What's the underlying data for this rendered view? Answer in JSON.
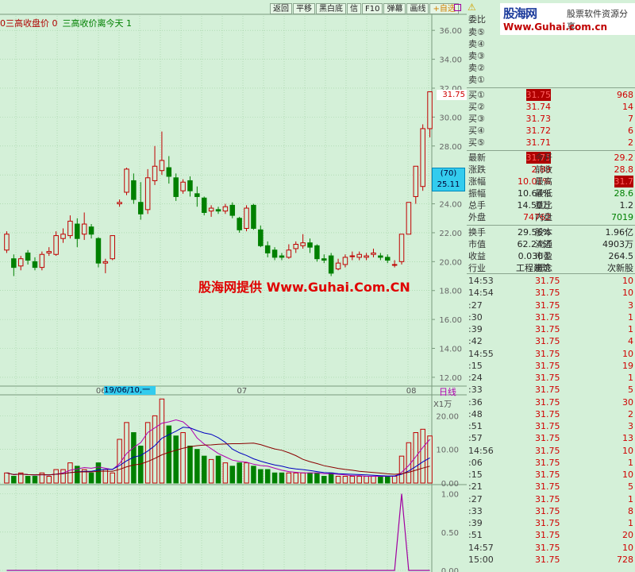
{
  "toolbar": {
    "buttons": [
      "返回",
      "平移",
      "黑白底",
      "信",
      "F10",
      "弹幕",
      "画线",
      "+自选"
    ]
  },
  "legend": {
    "text1": "0三高收盘价 0",
    "text2": "三高收价离今天 1"
  },
  "chart_data": [
    {
      "type": "candlestick",
      "title": "",
      "y_ticks": [
        "36.00",
        "34.00",
        "32.00",
        "30.00",
        "28.00",
        "26.00",
        "24.00",
        "22.00",
        "20.00",
        "18.00",
        "16.00",
        "14.00",
        "12.00"
      ],
      "ylim": [
        11.5,
        37.0
      ],
      "x_ticks": [
        "06",
        "07",
        "08"
      ],
      "candles": [
        {
          "o": 20.8,
          "c": 21.9,
          "h": 22.1,
          "l": 20.6
        },
        {
          "o": 20.2,
          "c": 19.6,
          "h": 20.5,
          "l": 19.0
        },
        {
          "o": 19.7,
          "c": 20.2,
          "h": 20.4,
          "l": 19.4
        },
        {
          "o": 20.6,
          "c": 20.1,
          "h": 20.8,
          "l": 19.8
        },
        {
          "o": 20.0,
          "c": 19.6,
          "h": 20.3,
          "l": 19.4
        },
        {
          "o": 19.6,
          "c": 20.5,
          "h": 20.7,
          "l": 19.4
        },
        {
          "o": 20.6,
          "c": 20.7,
          "h": 21.0,
          "l": 20.4
        },
        {
          "o": 20.5,
          "c": 21.8,
          "h": 22.1,
          "l": 20.4
        },
        {
          "o": 21.6,
          "c": 21.9,
          "h": 22.3,
          "l": 21.3
        },
        {
          "o": 21.8,
          "c": 22.8,
          "h": 23.2,
          "l": 21.6
        },
        {
          "o": 22.6,
          "c": 21.6,
          "h": 23.0,
          "l": 21.0
        },
        {
          "o": 21.9,
          "c": 22.6,
          "h": 23.4,
          "l": 21.5
        },
        {
          "o": 22.4,
          "c": 21.9,
          "h": 22.6,
          "l": 21.6
        },
        {
          "o": 21.6,
          "c": 19.9,
          "h": 21.7,
          "l": 19.6
        },
        {
          "o": 19.9,
          "c": 20.0,
          "h": 20.2,
          "l": 19.2
        },
        {
          "o": 20.2,
          "c": 21.8,
          "h": 21.8,
          "l": 20.1
        },
        {
          "o": 24.0,
          "c": 24.1,
          "h": 24.3,
          "l": 23.8
        },
        {
          "o": 24.8,
          "c": 26.4,
          "h": 26.5,
          "l": 24.6
        },
        {
          "o": 25.6,
          "c": 24.3,
          "h": 26.1,
          "l": 24.0
        },
        {
          "o": 24.1,
          "c": 23.3,
          "h": 25.5,
          "l": 22.9
        },
        {
          "o": 23.6,
          "c": 25.8,
          "h": 26.4,
          "l": 23.3
        },
        {
          "o": 25.6,
          "c": 26.6,
          "h": 28.0,
          "l": 25.3
        },
        {
          "o": 26.3,
          "c": 27.0,
          "h": 29.0,
          "l": 26.0
        },
        {
          "o": 26.5,
          "c": 25.9,
          "h": 27.3,
          "l": 25.4
        },
        {
          "o": 25.8,
          "c": 24.5,
          "h": 26.1,
          "l": 24.2
        },
        {
          "o": 24.9,
          "c": 25.5,
          "h": 25.7,
          "l": 24.7
        },
        {
          "o": 25.6,
          "c": 24.9,
          "h": 25.9,
          "l": 24.5
        },
        {
          "o": 24.7,
          "c": 24.5,
          "h": 25.2,
          "l": 23.8
        },
        {
          "o": 24.4,
          "c": 23.4,
          "h": 24.5,
          "l": 23.2
        },
        {
          "o": 23.5,
          "c": 23.7,
          "h": 23.9,
          "l": 23.1
        },
        {
          "o": 23.6,
          "c": 23.5,
          "h": 23.8,
          "l": 23.3
        },
        {
          "o": 23.5,
          "c": 23.8,
          "h": 24.0,
          "l": 23.3
        },
        {
          "o": 23.9,
          "c": 23.2,
          "h": 24.1,
          "l": 23.0
        },
        {
          "o": 23.0,
          "c": 22.2,
          "h": 23.1,
          "l": 22.0
        },
        {
          "o": 22.3,
          "c": 23.7,
          "h": 23.9,
          "l": 22.1
        },
        {
          "o": 23.9,
          "c": 22.3,
          "h": 24.0,
          "l": 22.2
        },
        {
          "o": 22.2,
          "c": 21.1,
          "h": 22.5,
          "l": 21.0
        },
        {
          "o": 21.1,
          "c": 20.6,
          "h": 21.4,
          "l": 20.3
        },
        {
          "o": 20.8,
          "c": 20.3,
          "h": 21.0,
          "l": 20.1
        },
        {
          "o": 20.4,
          "c": 20.3,
          "h": 20.6,
          "l": 20.1
        },
        {
          "o": 20.3,
          "c": 20.8,
          "h": 21.2,
          "l": 20.2
        },
        {
          "o": 20.9,
          "c": 21.2,
          "h": 21.4,
          "l": 20.6
        },
        {
          "o": 21.1,
          "c": 21.3,
          "h": 21.9,
          "l": 20.9
        },
        {
          "o": 21.3,
          "c": 21.0,
          "h": 21.6,
          "l": 20.6
        },
        {
          "o": 21.1,
          "c": 20.2,
          "h": 21.2,
          "l": 20.0
        },
        {
          "o": 20.2,
          "c": 20.1,
          "h": 20.5,
          "l": 19.9
        },
        {
          "o": 20.4,
          "c": 19.2,
          "h": 20.6,
          "l": 19.0
        },
        {
          "o": 19.5,
          "c": 19.9,
          "h": 20.2,
          "l": 19.4
        },
        {
          "o": 19.8,
          "c": 20.3,
          "h": 20.5,
          "l": 19.6
        },
        {
          "o": 20.4,
          "c": 20.4,
          "h": 20.7,
          "l": 20.1
        },
        {
          "o": 20.3,
          "c": 20.5,
          "h": 20.7,
          "l": 20.1
        },
        {
          "o": 20.3,
          "c": 20.4,
          "h": 20.6,
          "l": 20.1
        },
        {
          "o": 20.5,
          "c": 20.6,
          "h": 20.9,
          "l": 20.3
        },
        {
          "o": 20.4,
          "c": 20.3,
          "h": 20.6,
          "l": 20.1
        },
        {
          "o": 20.3,
          "c": 20.1,
          "h": 20.5,
          "l": 19.9
        },
        {
          "o": 19.8,
          "c": 19.8,
          "h": 20.1,
          "l": 19.6
        },
        {
          "o": 20.0,
          "c": 21.9,
          "h": 21.9,
          "l": 19.8
        },
        {
          "o": 21.9,
          "c": 24.1,
          "h": 24.1,
          "l": 21.9
        },
        {
          "o": 24.5,
          "c": 26.6,
          "h": 26.6,
          "l": 24.0
        },
        {
          "o": 25.2,
          "c": 29.2,
          "h": 29.5,
          "l": 24.9
        },
        {
          "o": 29.2,
          "c": 31.75,
          "h": 31.75,
          "l": 28.6
        }
      ]
    },
    {
      "type": "bar",
      "title": "",
      "unit": "X1万",
      "y_ticks": [
        "20.00",
        "10.00",
        "0.00"
      ],
      "ylim": [
        0,
        26
      ],
      "values": [
        3,
        2,
        3,
        2,
        2,
        3,
        2,
        4,
        4,
        6,
        5,
        4,
        3,
        6,
        4,
        3,
        13,
        18,
        15,
        11,
        18,
        20,
        25,
        17,
        14,
        15,
        11,
        10,
        8,
        7,
        8,
        6,
        5,
        6,
        6,
        5,
        4,
        4,
        3,
        3,
        3,
        3,
        3,
        3,
        3,
        2,
        3,
        2,
        2,
        2,
        2,
        2,
        2,
        2,
        2,
        2,
        8,
        12,
        15,
        16,
        14
      ]
    },
    {
      "type": "line",
      "title": "",
      "y_ticks": [
        "1.00",
        "0.50",
        "0.00"
      ],
      "ylim": [
        0,
        1.1
      ],
      "values": [
        0,
        0,
        0,
        0,
        0,
        0,
        0,
        0,
        0,
        0,
        0,
        0,
        0,
        0,
        0,
        0,
        0,
        0,
        0,
        0,
        0,
        0,
        0,
        0,
        0,
        0,
        0,
        0,
        0,
        0,
        0,
        0,
        0,
        0,
        0,
        0,
        0,
        0,
        0,
        0,
        0,
        0,
        0,
        0,
        0,
        0,
        0,
        0,
        0,
        0,
        0,
        0,
        0,
        0,
        0,
        0,
        1,
        0,
        0,
        0,
        0
      ]
    }
  ],
  "last_price_tag": "31.75",
  "cursor": {
    "label1": "(70)",
    "label2": "25.11"
  },
  "date_tag": "19/06/10,一",
  "period": "日线",
  "watermark": "股海网提供 Www.Guhai.Com.CN",
  "logo": {
    "name": "股海网",
    "sub": "股票软件资源分享",
    "url": "Www.Guhai.com.cn"
  },
  "order_book": {
    "ratio_label": "委比",
    "sells": [
      "卖⑤",
      "卖④",
      "卖③",
      "卖②",
      "卖①"
    ],
    "buys": [
      {
        "label": "买①",
        "price": "31.75",
        "vol": "968"
      },
      {
        "label": "买②",
        "price": "31.74",
        "vol": "14"
      },
      {
        "label": "买③",
        "price": "31.73",
        "vol": "7"
      },
      {
        "label": "买④",
        "price": "31.72",
        "vol": "6"
      },
      {
        "label": "买⑤",
        "price": "31.71",
        "vol": "2"
      }
    ]
  },
  "quote": [
    {
      "l1": "最新",
      "v1": "31.75",
      "l2": "今开",
      "v2": "29.2"
    },
    {
      "l1": "涨跌",
      "v1": "2.89",
      "l2": "前收",
      "v2": "28.8"
    },
    {
      "l1": "涨幅",
      "v1": "10.01%",
      "l2": "最高",
      "v2": "31.7"
    },
    {
      "l1": "振幅",
      "v1": "10.64%",
      "l2": "最低",
      "v2": "28.6"
    },
    {
      "l1": "总手",
      "v1": "14.50万",
      "l2": "量比",
      "v2": "1.2"
    },
    {
      "l1": "外盘",
      "v1": "74762",
      "l2": "内盘",
      "v2": "7019"
    }
  ],
  "info": [
    {
      "l1": "换手",
      "v1": "29.56%",
      "l2": "股本",
      "v2": "1.96亿"
    },
    {
      "l1": "市值",
      "v1": "62.24亿",
      "l2": "流通",
      "v2": "4903万"
    },
    {
      "l1": "收益",
      "v1": "0.030①",
      "l2": "市盈",
      "v2": "264.5"
    },
    {
      "l1": "行业",
      "v1": "工程建筑",
      "l2": "概念",
      "v2": "次新股"
    }
  ],
  "ticks": [
    {
      "t": "14:53",
      "p": "31.75",
      "v": "10"
    },
    {
      "t": "14:54",
      "p": "31.75",
      "v": "10"
    },
    {
      "t": ":27",
      "p": "31.75",
      "v": "3"
    },
    {
      "t": ":30",
      "p": "31.75",
      "v": "1"
    },
    {
      "t": ":39",
      "p": "31.75",
      "v": "1"
    },
    {
      "t": ":42",
      "p": "31.75",
      "v": "4"
    },
    {
      "t": "14:55",
      "p": "31.75",
      "v": "10"
    },
    {
      "t": ":15",
      "p": "31.75",
      "v": "19"
    },
    {
      "t": ":24",
      "p": "31.75",
      "v": "1"
    },
    {
      "t": ":33",
      "p": "31.75",
      "v": "5"
    },
    {
      "t": ":36",
      "p": "31.75",
      "v": "30"
    },
    {
      "t": ":48",
      "p": "31.75",
      "v": "2"
    },
    {
      "t": ":51",
      "p": "31.75",
      "v": "3"
    },
    {
      "t": ":57",
      "p": "31.75",
      "v": "13"
    },
    {
      "t": "14:56",
      "p": "31.75",
      "v": "10"
    },
    {
      "t": ":06",
      "p": "31.75",
      "v": "1"
    },
    {
      "t": ":15",
      "p": "31.75",
      "v": "10"
    },
    {
      "t": ":21",
      "p": "31.75",
      "v": "5"
    },
    {
      "t": ":27",
      "p": "31.75",
      "v": "1"
    },
    {
      "t": ":33",
      "p": "31.75",
      "v": "8"
    },
    {
      "t": ":39",
      "p": "31.75",
      "v": "1"
    },
    {
      "t": ":51",
      "p": "31.75",
      "v": "20"
    },
    {
      "t": "14:57",
      "p": "31.75",
      "v": "10"
    },
    {
      "t": "15:00",
      "p": "31.75",
      "v": "728"
    }
  ],
  "colors": {
    "up": "#c00000",
    "down": "#008000",
    "background": "#d4f0d8",
    "grid": "#9ccf9f",
    "ma1": "#b000b0",
    "ma2": "#0000c0",
    "ma3": "#8b0000",
    "signal": "#a000a0"
  }
}
